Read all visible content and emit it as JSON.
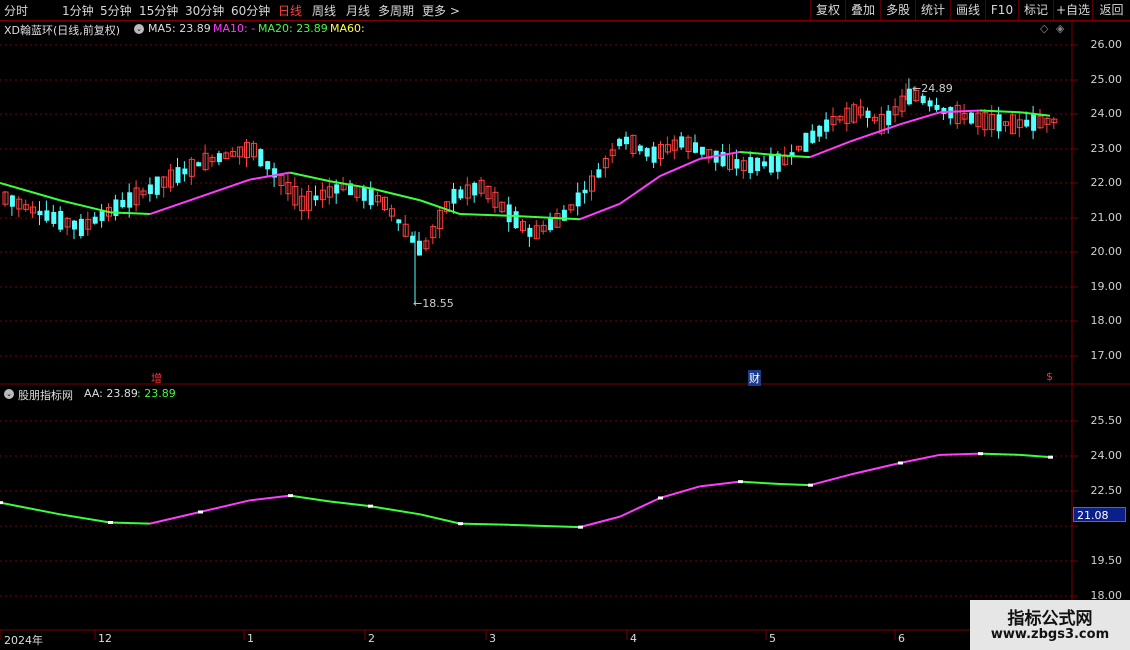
{
  "toolbar": {
    "periods": [
      "分时",
      "1分钟",
      "5分钟",
      "15分钟",
      "30分钟",
      "60分钟",
      "日线",
      "周线",
      "月线",
      "多周期",
      "更多 >"
    ],
    "active_period": "日线",
    "actions": [
      "复权",
      "叠加",
      "多股",
      "统计",
      "画线",
      "F10",
      "标记",
      "+自选",
      "返回"
    ]
  },
  "main_header": {
    "stock": "XD翰蓝环(日线,前复权)",
    "ma5_label": "MA5: 23.89",
    "ma10_label": "MA10: -",
    "ma20_label": "MA20: 23.89",
    "ma60_label": "MA60:"
  },
  "indicator_header": {
    "name": "股朋指标网",
    "aa_label": "AA: 23.89",
    "aa_value2": ": 23.89"
  },
  "price_axis": [
    "26.00",
    "25.00",
    "24.00",
    "23.00",
    "22.00",
    "21.00",
    "20.00",
    "19.00",
    "18.00",
    "17.00"
  ],
  "indicator_axis": [
    "25.50",
    "24.00",
    "22.50",
    "21.00",
    "19.50",
    "18.00"
  ],
  "cursor_value": "21.08",
  "annotations": {
    "high": "24.89",
    "low": "18.55"
  },
  "event_markers": [
    {
      "text": "增",
      "color": "#ff3030",
      "bg": "transparent"
    },
    {
      "text": "财",
      "color": "#ffffff",
      "bg": "#1a3a8a"
    },
    {
      "text": "$",
      "color": "#ff3030",
      "bg": "transparent"
    }
  ],
  "date_axis": [
    "2024年",
    "12",
    "1",
    "2",
    "3",
    "4",
    "5",
    "6"
  ],
  "watermark": {
    "line1": "指标公式网",
    "line2": "www.zbgs3.com"
  },
  "colors": {
    "up": "#ff4040",
    "down": "#54ffff",
    "ma_pink": "#ff3cff",
    "ma_green": "#3cff3c",
    "grid": "#7a0000"
  }
}
